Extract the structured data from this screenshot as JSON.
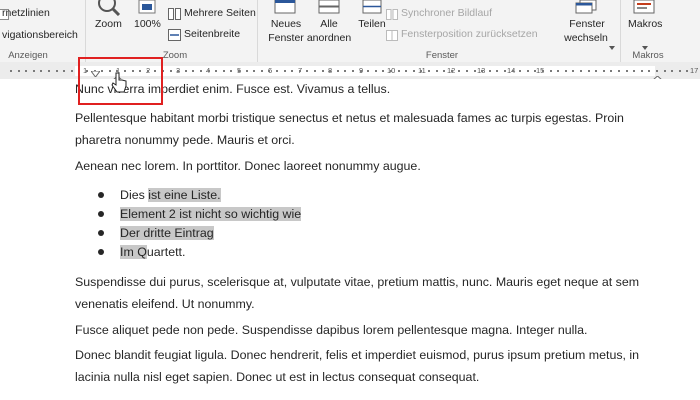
{
  "ribbon": {
    "anzeigen": {
      "lines_label": "rnetzlinien",
      "nav_label": "vigationsbereich",
      "group_label": "Anzeigen"
    },
    "zoom": {
      "zoom_label": "Zoom",
      "percent_label": "100%",
      "multi_pages_label": "Mehrere Seiten",
      "page_width_label": "Seitenbreite",
      "group_label": "Zoom"
    },
    "fenster": {
      "new_window_line1": "Neues",
      "new_window_line2": "Fenster",
      "arrange_all_line1": "Alle",
      "arrange_all_line2": "anordnen",
      "split_label": "Teilen",
      "sync_scroll_label": "Synchroner Bildlauf",
      "reset_position_label": "Fensterposition zurücksetzen",
      "switch_window_line1": "Fenster",
      "switch_window_line2": "wechseln",
      "group_label": "Fenster"
    },
    "makros": {
      "label": "Makros",
      "group_label": "Makros"
    }
  },
  "ruler": {
    "numbers": [
      "1",
      "1",
      "2",
      "3",
      "4",
      "5",
      "6",
      "7",
      "8",
      "9",
      "10",
      "11",
      "12",
      "13",
      "14",
      "15",
      "17"
    ]
  },
  "document": {
    "p1": "Nunc viverra imperdiet enim. Fusce est. Vivamus a tellus.",
    "p2": "Pellentesque habitant morbi tristique senectus et netus et malesuada fames ac turpis egestas. Proin pharetra nonummy pede. Mauris et orci.",
    "p3": "Aenean nec lorem. In porttitor. Donec laoreet nonummy augue.",
    "list": [
      {
        "pre": "Dies ",
        "hl": "ist eine Liste."
      },
      {
        "pre": "",
        "hl": "Element 2 ist nicht so wichtig wie"
      },
      {
        "pre": "",
        "hl": "Der dritte Eintrag"
      },
      {
        "pre": "",
        "hl": "Im Q",
        "post": "uartett."
      }
    ],
    "p4": "Suspendisse dui purus, scelerisque at, vulputate vitae, pretium mattis, nunc. Mauris eget neque at sem venenatis eleifend. Ut nonummy.",
    "p5": "Fusce aliquet pede non pede. Suspendisse dapibus lorem pellentesque magna. Integer nulla.",
    "p6": "Donec blandit feugiat ligula. Donec hendrerit, felis et imperdiet euismod, purus ipsum pretium metus, in lacinia nulla nisl eget sapien. Donec ut est in lectus consequat consequat."
  },
  "colors": {
    "highlight_box": "#e02020",
    "selection": "#c8c8c8",
    "ribbon_bg": "#f3f3f3",
    "accent_blue": "#2b579a"
  },
  "icons": [
    "checkbox-icon",
    "zoom-magnifier-icon",
    "zoom-100-icon",
    "multiple-pages-icon",
    "page-width-icon",
    "new-window-icon",
    "arrange-all-icon",
    "split-icon",
    "sync-scroll-icon",
    "reset-position-icon",
    "switch-window-icon",
    "macros-icon",
    "first-line-indent-marker-icon",
    "hanging-indent-marker-icon",
    "mouse-cursor-icon"
  ]
}
